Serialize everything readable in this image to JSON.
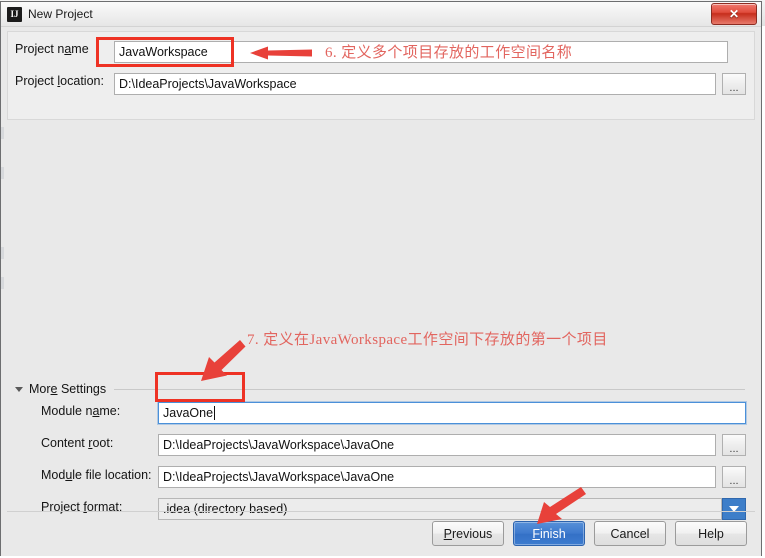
{
  "window": {
    "title": "New Project",
    "icon": "intellij-idea-icon",
    "close_label": "✕"
  },
  "form": {
    "project_name": {
      "label_pre": "Project n",
      "label_accel": "a",
      "label_post": "me",
      "value": "JavaWorkspace"
    },
    "project_location": {
      "label_pre": "Project ",
      "label_accel": "l",
      "label_post": "ocation:",
      "value": "D:\\IdeaProjects\\JavaWorkspace",
      "browse_label": "..."
    }
  },
  "more_settings": {
    "label_pre": "Mor",
    "label_accel": "e",
    "label_post": " Settings",
    "module_name": {
      "label_pre": "Module n",
      "label_accel": "a",
      "label_post": "me:",
      "value": "JavaOne"
    },
    "content_root": {
      "label_pre": "Content ",
      "label_accel": "r",
      "label_post": "oot:",
      "value": "D:\\IdeaProjects\\JavaWorkspace\\JavaOne",
      "browse_label": "..."
    },
    "module_file_location": {
      "label_pre": "Mod",
      "label_accel": "u",
      "label_post": "le file location:",
      "value": "D:\\IdeaProjects\\JavaWorkspace\\JavaOne",
      "browse_label": "..."
    },
    "project_format": {
      "label_pre": "Project ",
      "label_accel": "f",
      "label_post": "ormat:",
      "value": ".idea (directory based)"
    }
  },
  "buttons": {
    "previous": {
      "pre": "",
      "accel": "P",
      "post": "revious"
    },
    "finish": {
      "pre": "",
      "accel": "F",
      "post": "inish"
    },
    "cancel": {
      "pre": "Cancel",
      "accel": "",
      "post": ""
    },
    "help": {
      "pre": "Help",
      "accel": "",
      "post": ""
    }
  },
  "annotations": [
    {
      "id": "anno-6",
      "text": "6. 定义多个项目存放的工作空间名称"
    },
    {
      "id": "anno-7",
      "text": "7. 定义在JavaWorkspace工作空间下存放的第一个项目"
    }
  ],
  "colors": {
    "annotation_red": "#e2655f",
    "highlight_box": "#ee3224",
    "primary_button": "#3d79cd",
    "combo_arrow": "#3d7ec9",
    "dialog_bg": "#e9e9e9"
  }
}
